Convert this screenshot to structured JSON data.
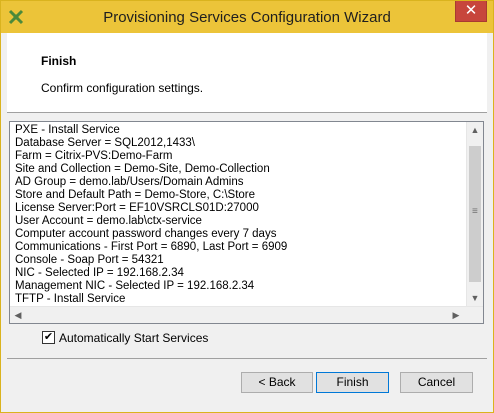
{
  "window": {
    "title": "Provisioning Services Configuration Wizard",
    "close_label": "✕"
  },
  "header": {
    "title": "Finish",
    "subtitle": "Confirm configuration settings."
  },
  "summary": {
    "lines": [
      "PXE - Install Service",
      "Database Server = SQL2012,1433\\",
      "Farm = Citrix-PVS:Demo-Farm",
      "Site and Collection = Demo-Site, Demo-Collection",
      "AD Group = demo.lab/Users/Domain Admins",
      "Store and Default Path = Demo-Store, C:\\Store",
      "License Server:Port = EF10VSRCLS01D:27000",
      "User Account = demo.lab\\ctx-service",
      "Computer account password changes every 7 days",
      "Communications - First Port = 6890, Last Port = 6909",
      "Console - Soap Port = 54321",
      "NIC - Selected IP = 192.168.2.34",
      "Management NIC - Selected IP = 192.168.2.34",
      "TFTP - Install Service"
    ]
  },
  "options": {
    "auto_start_label": "Automatically Start Services",
    "auto_start_checked": true,
    "check_glyph": "✔"
  },
  "buttons": {
    "back": "< Back",
    "finish": "Finish",
    "cancel": "Cancel"
  },
  "icons": {
    "app": "citrix-app-icon",
    "scroll_up": "▲",
    "scroll_down": "▼",
    "scroll_left": "◀",
    "scroll_right": "▶",
    "grip": "≡"
  },
  "colors": {
    "titlebar": "#ecc439",
    "accent": "#0078d7",
    "close": "#c7463c"
  }
}
